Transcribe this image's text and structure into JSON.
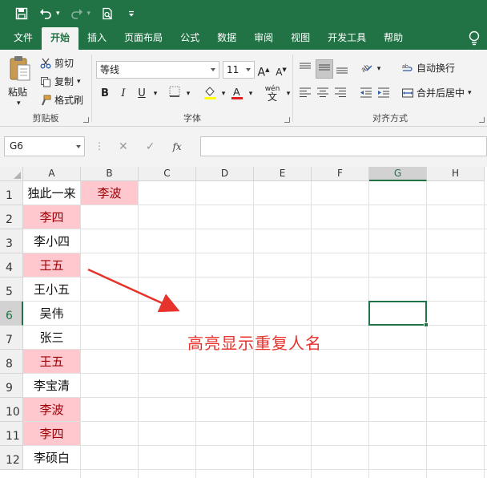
{
  "ribbon_tabs": [
    "文件",
    "开始",
    "插入",
    "页面布局",
    "公式",
    "数据",
    "审阅",
    "视图",
    "开发工具",
    "帮助"
  ],
  "active_tab": "开始",
  "clipboard": {
    "paste": "粘贴",
    "cut": "剪切",
    "copy": "复制",
    "format_painter": "格式刷",
    "title": "剪贴板"
  },
  "font": {
    "name": "等线",
    "size": "11",
    "grow": "A",
    "shrink": "A",
    "bold": "B",
    "italic": "I",
    "underline": "U",
    "phonetic": "wén",
    "title": "字体"
  },
  "alignment": {
    "wrap_text": "自动换行",
    "merge_center": "合并后居中",
    "title": "对齐方式"
  },
  "name_box": "G6",
  "fx_label": "fx",
  "columns": [
    "A",
    "B",
    "C",
    "D",
    "E",
    "F",
    "G",
    "H"
  ],
  "selected_column": "G",
  "rows": [
    "1",
    "2",
    "3",
    "4",
    "5",
    "6",
    "7",
    "8",
    "9",
    "10",
    "11",
    "12"
  ],
  "selected_row": "6",
  "column_a": [
    "独此一来",
    "李四",
    "李小四",
    "王五",
    "王小五",
    "吴伟",
    "张三",
    "王五",
    "李宝清",
    "李波",
    "李四",
    "李硕白"
  ],
  "column_a_duplicate": [
    false,
    true,
    false,
    true,
    false,
    false,
    false,
    true,
    false,
    true,
    true,
    false
  ],
  "cell_b1": "李波",
  "annotation": "高亮显示重复人名",
  "colors": {
    "excel_green": "#217346",
    "dup_fill": "#ffc7ce",
    "dup_text": "#9c0006",
    "annotation_red": "#e8322c"
  }
}
